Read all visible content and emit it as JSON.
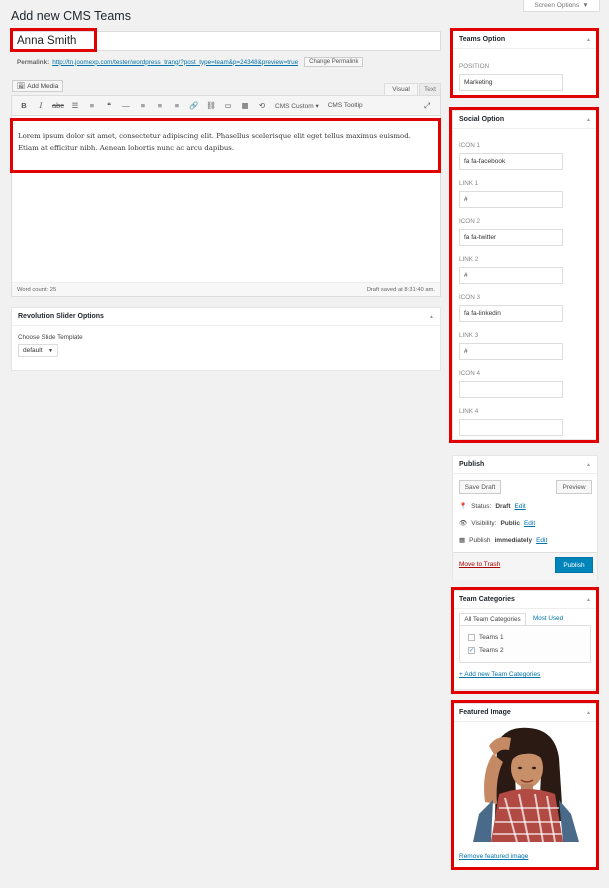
{
  "screen_options": "Screen Options",
  "page_title": "Add new CMS Teams",
  "post_title": "Anna Smith",
  "permalink": {
    "label": "Permalink:",
    "url": "http://tn.joomexp.com/tester/wordpress_trang/?post_type=team&p=24348&preview=true",
    "button": "Change Permalink"
  },
  "editor": {
    "add_media": "Add Media",
    "tab_visual": "Visual",
    "tab_text": "Text",
    "toolbar": {
      "cms_custom": "CMS Custom",
      "cms_tooltip": "CMS Tooltip"
    },
    "content": "Lorem ipsum dolor sit amet, consectetur adipiscing elit. Phasellus scelerisque elit eget tellus maximus euismod. Etiam at efficitur nibh. Aenean lobortis nunc ac arcu dapibus.",
    "word_count": "Word count: 25",
    "draft_saved": "Draft saved at 8:31:40 am."
  },
  "revolution": {
    "title": "Revolution Slider Options",
    "label": "Choose Slide Template",
    "value": "default"
  },
  "teams_option": {
    "title": "Teams Option",
    "position_label": "POSITION",
    "position_value": "Marketing"
  },
  "social_option": {
    "title": "Social Option",
    "fields": [
      {
        "label": "ICON 1",
        "value": "fa fa-facebook"
      },
      {
        "label": "LINK 1",
        "value": "#"
      },
      {
        "label": "ICON 2",
        "value": "fa fa-twitter"
      },
      {
        "label": "LINK 2",
        "value": "#"
      },
      {
        "label": "ICON 3",
        "value": "fa  fa-linkedin"
      },
      {
        "label": "LINK 3",
        "value": "#"
      },
      {
        "label": "ICON 4",
        "value": ""
      },
      {
        "label": "LINK 4",
        "value": ""
      }
    ]
  },
  "publish": {
    "title": "Publish",
    "save_draft": "Save Draft",
    "preview": "Preview",
    "status_label": "Status:",
    "status_value": "Draft",
    "visibility_label": "Visibility:",
    "visibility_value": "Public",
    "publish_label": "Publish",
    "publish_value": "immediately",
    "edit": "Edit",
    "move_to_trash": "Move to Trash",
    "publish_button": "Publish"
  },
  "team_categories": {
    "title": "Team Categories",
    "tab_all": "All Team Categories",
    "tab_most_used": "Most Used",
    "items": [
      {
        "label": "Teams 1",
        "checked": false
      },
      {
        "label": "Teams 2",
        "checked": true
      }
    ],
    "add_new": "+ Add new Team Categories"
  },
  "featured_image": {
    "title": "Featured Image",
    "remove": "Remove featured image"
  },
  "colors": {
    "highlight": "#e00000",
    "primary": "#0085ba",
    "link": "#0073aa"
  }
}
